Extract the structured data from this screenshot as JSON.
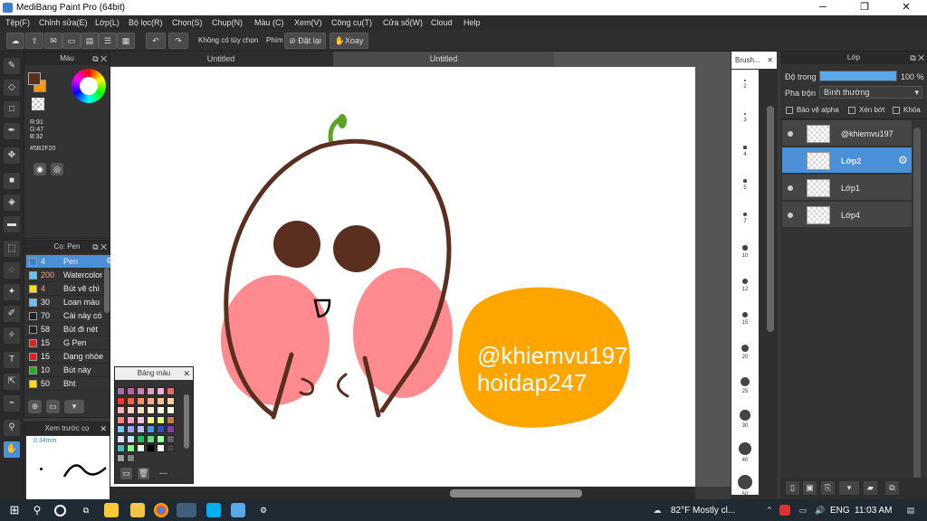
{
  "window": {
    "title": "MediBang Paint Pro (64bit)",
    "minimize": "─",
    "maximize": "❐",
    "close": "✕"
  },
  "menu": [
    "Tệp(F)",
    "Chỉnh sửa(E)",
    "Lớp(L)",
    "Bộ lọc(R)",
    "Chọn(S)",
    "Chụp(N)",
    "Màu (C)",
    "Xem(V)",
    "Công cụ(T)",
    "Cửa sổ(W)",
    "Cloud",
    "Help"
  ],
  "toolbar": {
    "no_option": "Không có tùy chọn",
    "key_label": "Phím",
    "undo_label": "Đặt lại",
    "rotate_label": "Xoay"
  },
  "tabs": [
    "Untitled",
    "Untitled"
  ],
  "color_panel": {
    "title": "Màu",
    "r": "R:91",
    "g": "G:47",
    "b": "B:32",
    "hex": "#5B2F20",
    "fg_color": "#5b2f20",
    "bg_color": "#ff9900"
  },
  "brush_panel": {
    "title": "Cọ: Pen",
    "items": [
      {
        "size": "4",
        "name": "Pen",
        "color": "#3a7fd5",
        "selected": true
      },
      {
        "size": "200",
        "name": "Watercolor",
        "color": "#5ac8fa",
        "selected": false
      },
      {
        "size": "4",
        "name": "Bút vẽ chì",
        "color": "#ffdd00",
        "selected": false
      },
      {
        "size": "30",
        "name": "Loan màu",
        "color": "#5ac8fa",
        "selected": false
      },
      {
        "size": "70",
        "name": "Cài này có",
        "color": "#222222",
        "selected": false
      },
      {
        "size": "58",
        "name": "Bút đi nét",
        "color": "#222222",
        "selected": false
      },
      {
        "size": "15",
        "name": "G Pen",
        "color": "#e02020",
        "selected": false
      },
      {
        "size": "15",
        "name": "Dạng nhòe",
        "color": "#e02020",
        "selected": false
      },
      {
        "size": "10",
        "name": "Bút này",
        "color": "#20b020",
        "selected": false
      },
      {
        "size": "50",
        "name": "Bht",
        "color": "#ffdd00",
        "selected": false
      }
    ]
  },
  "palette_panel": {
    "title": "Bảng màu",
    "more": "---"
  },
  "preview_panel": {
    "title": "Xem trước cọ",
    "size": "0.34mm"
  },
  "brush_size_panel": {
    "title": "Brush...",
    "sizes": [
      "2",
      "3",
      "4",
      "5",
      "7",
      "10",
      "12",
      "15",
      "20",
      "25",
      "30",
      "40",
      "50"
    ]
  },
  "layer_panel": {
    "title": "Lớp",
    "opacity_label": "Độ trong",
    "opacity_value": "100 %",
    "opacity": 1.0,
    "blend_label": "Pha trộn",
    "blend_value": "Bình thường",
    "protect_alpha": "Bảo vệ alpha",
    "clipping": "Xén bớt",
    "lock": "Khóa",
    "layers": [
      {
        "name": "@khiemvu197",
        "selected": false
      },
      {
        "name": "Lớp2",
        "selected": true
      },
      {
        "name": "Lớp1",
        "selected": false
      },
      {
        "name": "Lớp4",
        "selected": false
      }
    ]
  },
  "canvas": {
    "text_line1": "@khiemvu197",
    "text_line2": "hoidap247",
    "blob_color": "#ffa500",
    "outline_color": "#5b2f20",
    "cheek_color": "#ff8a8f",
    "sprout_color": "#5aa520"
  },
  "taskbar": {
    "weather": "82°F  Mostly cl...",
    "lang": "ENG",
    "time": "11:03 AM"
  }
}
